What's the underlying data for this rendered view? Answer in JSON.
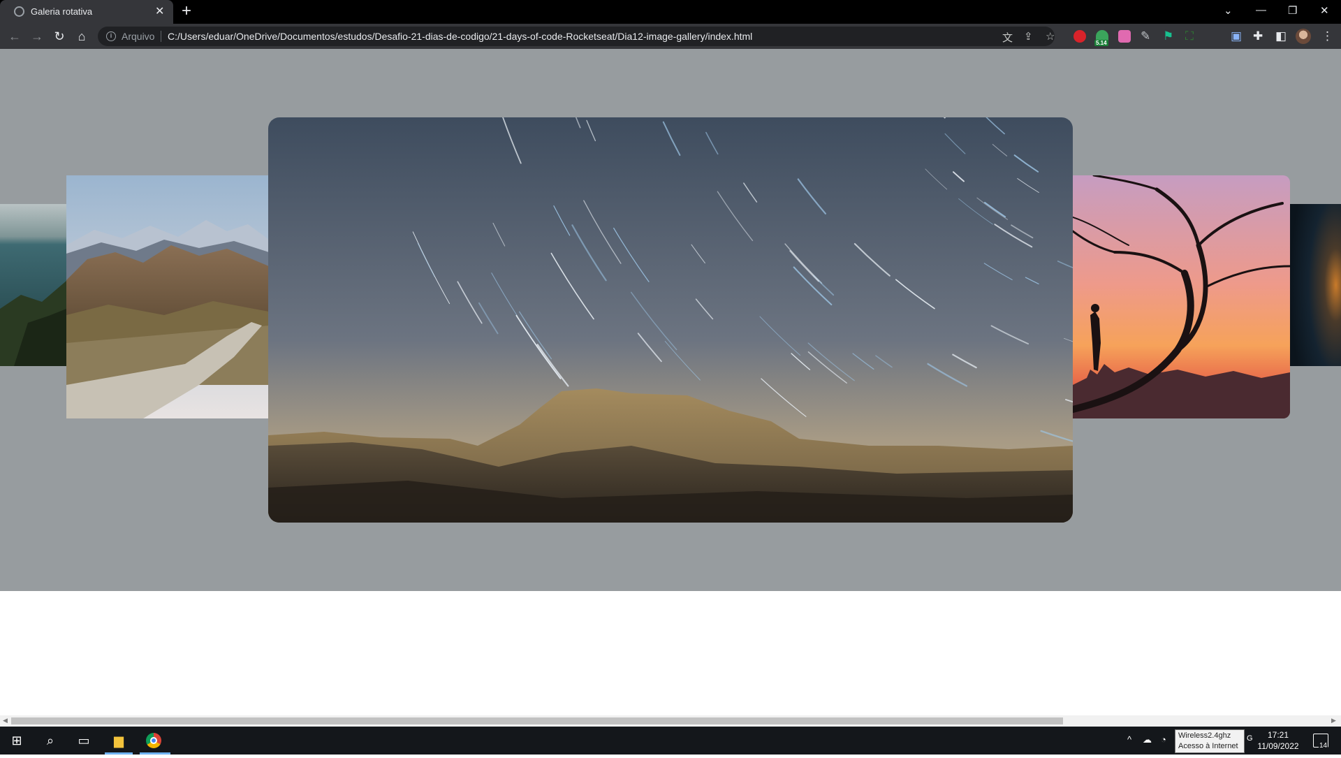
{
  "browser": {
    "tab_title": "Galeria rotativa",
    "tab_close": "✕",
    "new_tab": "+",
    "url_scheme_label": "Arquivo",
    "url": "C:/Users/eduar/OneDrive/Documentos/estudos/Desafio-21-dias-de-codigo/21-days-of-code-Rocketseat/Dia12-image-gallery/index.html",
    "extension_badge": "5.14",
    "icons": {
      "back": "arrow-left-icon",
      "forward": "arrow-right-icon",
      "reload": "reload-icon",
      "home": "home-icon",
      "translate": "translate-icon",
      "share": "share-icon",
      "bookmark": "star-icon",
      "extensions": "puzzle-icon",
      "side_panel": "side-panel-icon",
      "menu": "kebab-menu-icon"
    }
  },
  "gallery": {
    "slides": [
      {
        "name": "ocean-cliffs",
        "position": "far-left"
      },
      {
        "name": "desert-mountains-road",
        "position": "left"
      },
      {
        "name": "star-trails-mesa",
        "position": "center",
        "active": true
      },
      {
        "name": "tree-sunset-city",
        "position": "right"
      },
      {
        "name": "dark-cave",
        "position": "far-right"
      }
    ],
    "background_color": "#979c9f"
  },
  "taskbar": {
    "wifi_tooltip_line1": "Wireless2.4ghz",
    "wifi_tooltip_line2": "Acesso à Internet",
    "time": "17:21",
    "date": "11/09/2022",
    "notification_count": "14",
    "tray_hidden_letter": "G"
  }
}
